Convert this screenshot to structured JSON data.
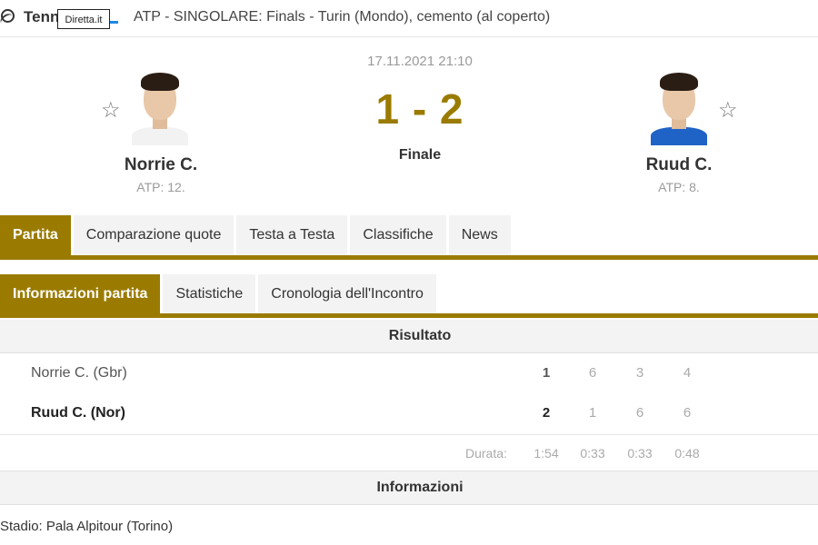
{
  "topbar": {
    "sport": "Tenn",
    "tooltip": "Diretta.it",
    "tournament": "ATP - SINGOLARE: Finals - Turin (Mondo), cemento (al coperto)"
  },
  "match": {
    "datetime": "17.11.2021 21:10",
    "score": "1 - 2",
    "status": "Finale",
    "home": {
      "name": "Norrie C.",
      "rank": "ATP: 12."
    },
    "away": {
      "name": "Ruud C.",
      "rank": "ATP: 8."
    }
  },
  "tabs": [
    "Partita",
    "Comparazione quote",
    "Testa a Testa",
    "Classifiche",
    "News"
  ],
  "subtabs": [
    "Informazioni partita",
    "Statistiche",
    "Cronologia dell'Incontro"
  ],
  "result": {
    "title": "Risultato",
    "rows": [
      {
        "name": "Norrie C. (Gbr)",
        "total": "1",
        "sets": [
          "6",
          "3",
          "4"
        ]
      },
      {
        "name": "Ruud C. (Nor)",
        "total": "2",
        "sets": [
          "1",
          "6",
          "6"
        ]
      }
    ],
    "duration_label": "Durata:",
    "duration_total": "1:54",
    "duration_sets": [
      "0:33",
      "0:33",
      "0:48"
    ]
  },
  "info": {
    "title": "Informazioni",
    "stadium": "Stadio: Pala Alpitour (Torino)"
  },
  "icons": {
    "sport": "tennis-ball-icon",
    "favorite": "star-outline-icon"
  },
  "colors": {
    "accent": "#9a7b00",
    "tab_bg": "#f3f3f3"
  }
}
